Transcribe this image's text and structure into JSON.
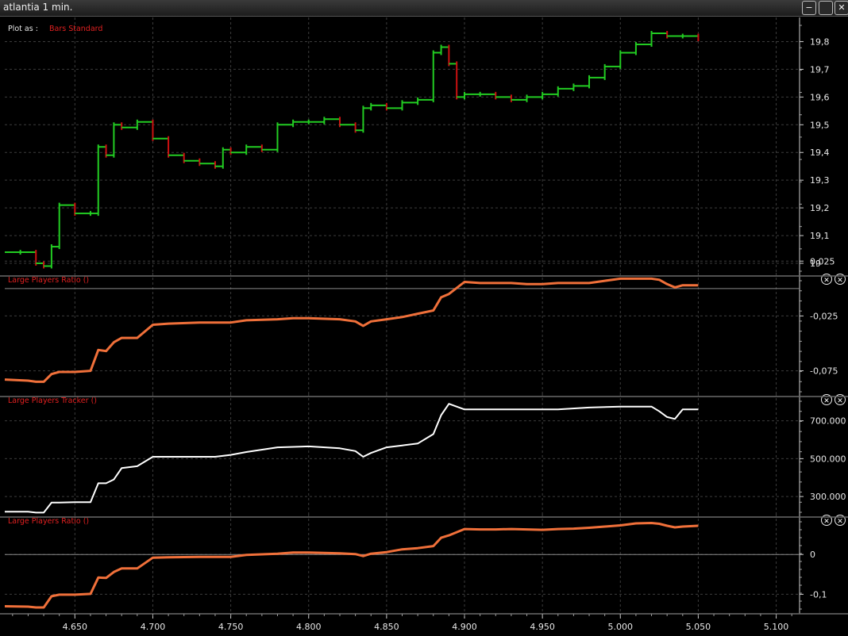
{
  "window": {
    "title": "atlantia  1 min.",
    "buttons": {
      "minimize": "−",
      "maximize": "",
      "close": "✕"
    }
  },
  "colors": {
    "up_bar": "#22cc22",
    "down_bar": "#cc1111",
    "ratio_line": "#f0703a",
    "tracker_line": "#ffffff",
    "label_red": "#e02020"
  },
  "plot_as": {
    "label": "Plot as :",
    "value": "Bars Standard"
  },
  "close_icon_glyph": "Ⓧ",
  "chart_data": [
    {
      "type": "line",
      "title": "",
      "subtype": "ohlc-bars",
      "xlabel": "",
      "ylabel": "",
      "ylim": [
        18.96,
        19.87
      ],
      "xlim": [
        4.605,
        5.115
      ],
      "yticks": [
        "19",
        "19,1",
        "19,2",
        "19,3",
        "19,4",
        "19,5",
        "19,6",
        "19,7",
        "19,8"
      ],
      "series": [
        {
          "x": [
            4.605,
            4.615,
            4.625,
            4.63,
            4.635,
            4.64,
            4.65,
            4.66,
            4.665,
            4.67,
            4.675,
            4.68,
            4.69,
            4.7,
            4.71,
            4.72,
            4.73,
            4.74,
            4.745,
            4.75,
            4.76,
            4.77,
            4.78,
            4.79,
            4.8,
            4.81,
            4.82,
            4.83,
            4.835,
            4.84,
            4.85,
            4.86,
            4.87,
            4.88,
            4.885,
            4.89,
            4.895,
            4.9,
            4.91,
            4.92,
            4.93,
            4.94,
            4.95,
            4.96,
            4.97,
            4.98,
            4.99,
            5.0,
            5.01,
            5.02,
            5.03,
            5.04,
            5.05
          ],
          "y": [
            19.04,
            19.04,
            19.0,
            18.99,
            19.06,
            19.21,
            19.18,
            19.18,
            19.42,
            19.39,
            19.5,
            19.49,
            19.51,
            19.45,
            19.39,
            19.37,
            19.36,
            19.35,
            19.41,
            19.4,
            19.42,
            19.41,
            19.5,
            19.51,
            19.51,
            19.52,
            19.5,
            19.48,
            19.56,
            19.57,
            19.56,
            19.58,
            19.59,
            19.76,
            19.78,
            19.72,
            19.6,
            19.61,
            19.61,
            19.6,
            19.59,
            19.6,
            19.61,
            19.63,
            19.64,
            19.67,
            19.71,
            19.76,
            19.79,
            19.83,
            19.82,
            19.82,
            19.81
          ]
        }
      ]
    },
    {
      "type": "line",
      "title": "Large Players Ratio ()",
      "xlabel": "",
      "ylabel": "",
      "ylim": [
        -0.097,
        0.01
      ],
      "xlim": [
        4.605,
        5.115
      ],
      "yticks": [
        "-0,075",
        "-0,025",
        "0,025"
      ],
      "series": [
        {
          "x": [
            4.605,
            4.62,
            4.625,
            4.63,
            4.635,
            4.64,
            4.65,
            4.66,
            4.665,
            4.67,
            4.675,
            4.68,
            4.69,
            4.7,
            4.71,
            4.73,
            4.75,
            4.76,
            4.78,
            4.79,
            4.8,
            4.82,
            4.83,
            4.835,
            4.84,
            4.85,
            4.86,
            4.87,
            4.88,
            4.885,
            4.89,
            4.9,
            4.91,
            4.92,
            4.93,
            4.94,
            4.95,
            4.96,
            4.97,
            4.98,
            4.99,
            5.0,
            5.01,
            5.02,
            5.025,
            5.03,
            5.035,
            5.04,
            5.05
          ],
          "y": [
            -0.083,
            -0.084,
            -0.085,
            -0.085,
            -0.078,
            -0.076,
            -0.076,
            -0.075,
            -0.056,
            -0.057,
            -0.049,
            -0.045,
            -0.045,
            -0.033,
            -0.032,
            -0.031,
            -0.031,
            -0.029,
            -0.028,
            -0.027,
            -0.027,
            -0.028,
            -0.03,
            -0.034,
            -0.03,
            -0.028,
            -0.026,
            -0.023,
            -0.02,
            -0.008,
            -0.005,
            0.006,
            0.005,
            0.005,
            0.005,
            0.004,
            0.004,
            0.005,
            0.005,
            0.005,
            0.007,
            0.009,
            0.009,
            0.009,
            0.008,
            0.004,
            0.001,
            0.003,
            0.003
          ]
        }
      ]
    },
    {
      "type": "line",
      "title": "Large Players Tracker ()",
      "xlabel": "",
      "ylabel": "",
      "ylim": [
        200000,
        820000
      ],
      "xlim": [
        4.605,
        5.115
      ],
      "yticks": [
        "300.000",
        "500.000",
        "700.000"
      ],
      "series": [
        {
          "x": [
            4.605,
            4.61,
            4.62,
            4.625,
            4.63,
            4.635,
            4.64,
            4.65,
            4.66,
            4.665,
            4.67,
            4.675,
            4.68,
            4.69,
            4.7,
            4.72,
            4.74,
            4.75,
            4.76,
            4.78,
            4.8,
            4.82,
            4.83,
            4.835,
            4.84,
            4.85,
            4.86,
            4.87,
            4.88,
            4.885,
            4.89,
            4.9,
            4.92,
            4.94,
            4.96,
            4.98,
            5.0,
            5.01,
            5.02,
            5.025,
            5.03,
            5.035,
            5.04,
            5.05
          ],
          "y": [
            220000,
            220000,
            220000,
            215000,
            215000,
            268000,
            268000,
            270000,
            270000,
            370000,
            370000,
            390000,
            450000,
            460000,
            510000,
            510000,
            510000,
            520000,
            535000,
            560000,
            565000,
            555000,
            540000,
            510000,
            530000,
            560000,
            570000,
            580000,
            630000,
            730000,
            790000,
            760000,
            760000,
            760000,
            760000,
            770000,
            775000,
            775000,
            775000,
            750000,
            720000,
            710000,
            760000,
            760000
          ]
        }
      ]
    },
    {
      "type": "line",
      "title": "Large Players Ratio ()",
      "xlabel": "",
      "ylabel": "",
      "ylim": [
        -0.145,
        0.09
      ],
      "xlim": [
        4.605,
        5.115
      ],
      "yticks": [
        "-0,1",
        "0"
      ],
      "series": [
        {
          "x": [
            4.605,
            4.62,
            4.625,
            4.63,
            4.635,
            4.64,
            4.65,
            4.66,
            4.665,
            4.67,
            4.675,
            4.68,
            4.69,
            4.7,
            4.71,
            4.73,
            4.75,
            4.76,
            4.78,
            4.79,
            4.8,
            4.82,
            4.83,
            4.835,
            4.84,
            4.85,
            4.86,
            4.87,
            4.88,
            4.885,
            4.89,
            4.9,
            4.91,
            4.92,
            4.93,
            4.94,
            4.95,
            4.96,
            4.97,
            4.98,
            4.99,
            5.0,
            5.01,
            5.02,
            5.025,
            5.03,
            5.035,
            5.04,
            5.05
          ],
          "y": [
            -0.13,
            -0.131,
            -0.133,
            -0.133,
            -0.105,
            -0.101,
            -0.101,
            -0.099,
            -0.058,
            -0.059,
            -0.044,
            -0.035,
            -0.035,
            -0.008,
            -0.007,
            -0.006,
            -0.006,
            -0.001,
            0.002,
            0.005,
            0.005,
            0.003,
            0.001,
            -0.004,
            0.002,
            0.006,
            0.013,
            0.016,
            0.021,
            0.042,
            0.048,
            0.064,
            0.063,
            0.063,
            0.064,
            0.063,
            0.062,
            0.064,
            0.065,
            0.067,
            0.07,
            0.073,
            0.078,
            0.079,
            0.077,
            0.072,
            0.068,
            0.07,
            0.072
          ]
        }
      ]
    }
  ],
  "x_axis": {
    "ticks": [
      "4.650",
      "4.700",
      "4.750",
      "4.800",
      "4.850",
      "4.900",
      "4.950",
      "5.000",
      "5.050",
      "5.100"
    ]
  }
}
